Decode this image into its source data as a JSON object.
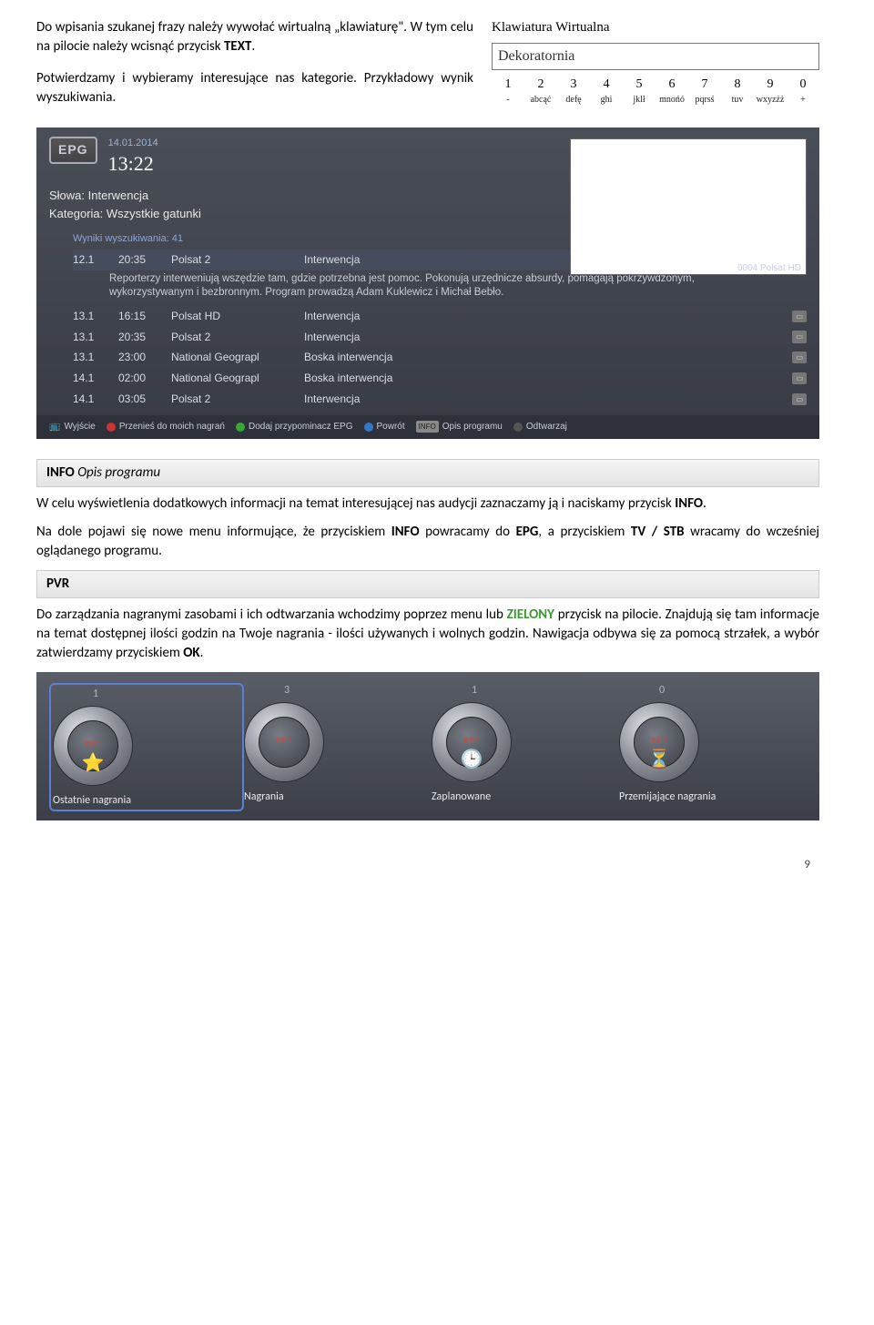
{
  "top": {
    "p1a": "Do wpisania szukanej frazy należy wywołać wirtualną „klawiaturę\". W tym celu na pilocie należy wcisnąć przycisk ",
    "p1b": "TEXT",
    "p1c": ".",
    "p2": "Potwierdzamy i wybieramy interesujące nas kategorie. Przykładowy wynik wyszukiwania."
  },
  "vk": {
    "title": "Klawiatura Wirtualna",
    "input": "Dekoratornia",
    "r1": [
      "1",
      "2",
      "3",
      "4",
      "5",
      "6",
      "7",
      "8",
      "9",
      "0"
    ],
    "r2": [
      "-",
      "abcąć",
      "defę",
      "ghi",
      "jklł",
      "mnońó",
      "pqrsś",
      "tuv",
      "wxyzźż",
      "+"
    ]
  },
  "epg": {
    "logo": "EPG",
    "date": "14.01.2014",
    "time": "13:22",
    "preview_label": "0004 Polsat HD",
    "slowa_label": "Słowa:",
    "slowa_val": "Interwencja",
    "kat_label": "Kategoria:",
    "kat_val": "Wszystkie gatunki",
    "wyniki": "Wyniki wyszukiwania: 41",
    "rows": [
      {
        "d": "12.1",
        "t": "20:35",
        "ch": "Polsat 2",
        "title": "Interwencja",
        "sel": true
      },
      {
        "d": "13.1",
        "t": "16:15",
        "ch": "Polsat HD",
        "title": "Interwencja"
      },
      {
        "d": "13.1",
        "t": "20:35",
        "ch": "Polsat 2",
        "title": "Interwencja"
      },
      {
        "d": "13.1",
        "t": "23:00",
        "ch": "National Geograpl",
        "title": "Boska interwencja"
      },
      {
        "d": "14.1",
        "t": "02:00",
        "ch": "National Geograpl",
        "title": "Boska interwencja"
      },
      {
        "d": "14.1",
        "t": "03:05",
        "ch": "Polsat 2",
        "title": "Interwencja"
      }
    ],
    "desc": "Reporterzy interweniują wszędzie tam, gdzie potrzebna jest pomoc. Pokonują urzędnicze absurdy, pomagają pokrzywdzonym, wykorzystywanym i bezbronnym. Program prowadzą Adam Kuklewicz i Michał Bebło.",
    "footer": [
      {
        "icon": "tv",
        "label": "Wyjście"
      },
      {
        "icon": "red",
        "label": "Przenieś do moich nagrań"
      },
      {
        "icon": "green",
        "label": "Dodaj przypominacz EPG"
      },
      {
        "icon": "blue",
        "label": "Powrót"
      },
      {
        "icon": "info",
        "label": "Opis programu"
      },
      {
        "icon": "play",
        "label": "Odtwarzaj"
      }
    ]
  },
  "section_info": {
    "prefix": "INFO ",
    "title": "Opis programu",
    "p1a": "W celu wyświetlenia dodatkowych informacji na temat interesującej nas audycji zaznaczamy ją i naciskamy przycisk ",
    "p1b": "INFO",
    "p1c": ".",
    "p2a": "Na dole pojawi się nowe  menu informujące, że przyciskiem ",
    "p2b": "INFO",
    "p2c": " powracamy do ",
    "p2d": "EPG",
    "p2e": ", a  przyciskiem ",
    "p2f": "TV / STB",
    "p2g": " wracamy do wcześniej oglądanego programu."
  },
  "section_pvr": {
    "title": "PVR",
    "p1a": "Do zarządzania nagranymi zasobami i ich odtwarzania wchodzimy poprzez menu lub ",
    "p1b": "ZIELONY",
    "p1c": " przycisk na pilocie. Znajdują się tam informacje na temat dostępnej ilości godzin na Twoje nagrania - ilości używanych i wolnych godzin. Nawigacja odbywa się za pomocą strzałek, a wybór zatwierdzamy przyciskiem ",
    "p1d": "OK",
    "p1e": "."
  },
  "pvr_icons": {
    "rec": "REC",
    "items": [
      {
        "num": "1",
        "label": "Ostatnie nagrania",
        "overlay": "⭐",
        "sel": true
      },
      {
        "num": "3",
        "label": "Nagrania",
        "overlay": ""
      },
      {
        "num": "1",
        "label": "Zaplanowane",
        "overlay": "🕒"
      },
      {
        "num": "0",
        "label": "Przemijające nagrania",
        "overlay": "⏳"
      }
    ]
  },
  "pagenum": "9"
}
